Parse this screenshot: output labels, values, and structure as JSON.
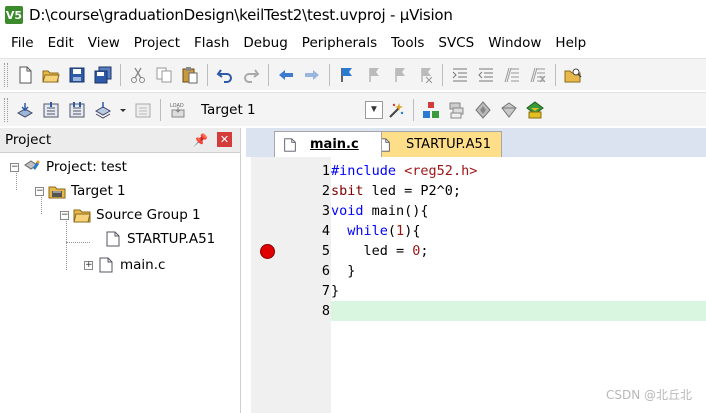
{
  "window": {
    "title": "D:\\course\\graduationDesign\\keilTest2\\test.uvproj - µVision",
    "app_icon_text": "V5"
  },
  "menu": [
    "File",
    "Edit",
    "View",
    "Project",
    "Flash",
    "Debug",
    "Peripherals",
    "Tools",
    "SVCS",
    "Window",
    "Help"
  ],
  "toolbar2": {
    "target_value": "Target 1",
    "load_label": "LOAD"
  },
  "project_panel": {
    "title": "Project",
    "tree": {
      "root": "Project: test",
      "target": "Target 1",
      "group": "Source Group 1",
      "file1": "STARTUP.A51",
      "file2": "main.c"
    }
  },
  "editor": {
    "tabs": [
      "main.c",
      "STARTUP.A51"
    ],
    "active_tab": "main.c",
    "line_numbers": [
      "1",
      "2",
      "3",
      "4",
      "5",
      "6",
      "7",
      "8"
    ],
    "breakpoint_line": 5,
    "current_line": 8,
    "code": {
      "l1_pp": "#include",
      "l1_str": "<reg52.h>",
      "l2_kw": "sbit",
      "l2_rest": " led = P2^0;",
      "l3_kw": "void",
      "l3_rest": " main(){",
      "l4_indent": "  ",
      "l4_kw": "while",
      "l4_paren_open": "(",
      "l4_num": "1",
      "l4_rest": "){",
      "l5_rest": "    led = ",
      "l5_num": "0",
      "l5_semi": ";",
      "l6": "  }",
      "l7": "}",
      "l8": ""
    }
  },
  "watermark": "CSDN @北丘北",
  "colors": {
    "keyword": "#0000ff",
    "string": "#9b1414",
    "breakpoint": "#e00000",
    "current_line": "#d9f7e0",
    "startup_tab": "#ffde8a"
  }
}
